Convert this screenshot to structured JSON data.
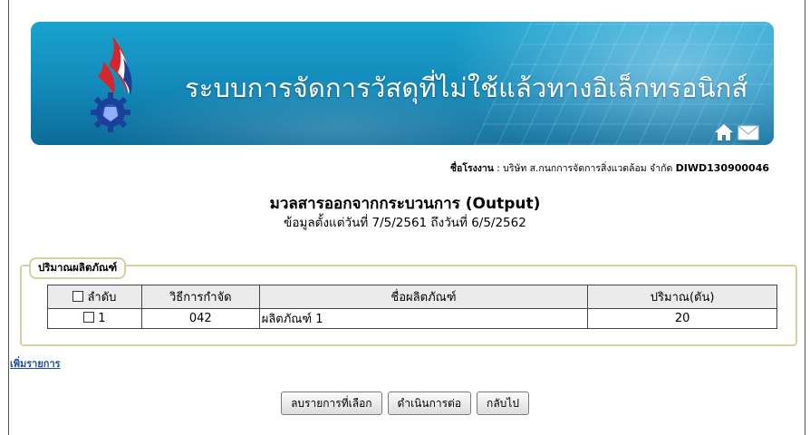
{
  "banner": {
    "title": "ระบบการจัดการวัสดุที่ไม่ใช้แล้วทางอิเล็กทรอนิกส์",
    "icons": [
      "home-icon",
      "mail-icon"
    ],
    "colors": {
      "primary": "#1288b8",
      "accent_red": "#d6252b"
    }
  },
  "factory": {
    "label": "ชื่อโรงงาน",
    "name": ": บริษัท ส.กนกการจัดการสิ่งแวดล้อม จำกัด",
    "code": "DIWD130900046"
  },
  "page": {
    "title": "มวลสารออกจากกระบวนการ (Output)",
    "date_range": "ข้อมูลตั้งแต่วันที่ 7/5/2561 ถึงวันที่ 6/5/2562"
  },
  "products": {
    "legend": "ปริมาณผลิตภัณฑ์",
    "columns": [
      "ลำดับ",
      "วิธีการกำจัด",
      "ชื่อผลิตภัณฑ์",
      "ปริมาณ(ตัน)"
    ],
    "rows": [
      {
        "seq": "1",
        "method": "042",
        "name": "ผลิตภัณฑ์ 1",
        "quantity": "20"
      }
    ]
  },
  "actions": {
    "add_item": "เพิ่มรายการ",
    "delete_selected": "ลบรายการที่เลือก",
    "continue": "ดำเนินการต่อ",
    "back": "กลับไป"
  }
}
